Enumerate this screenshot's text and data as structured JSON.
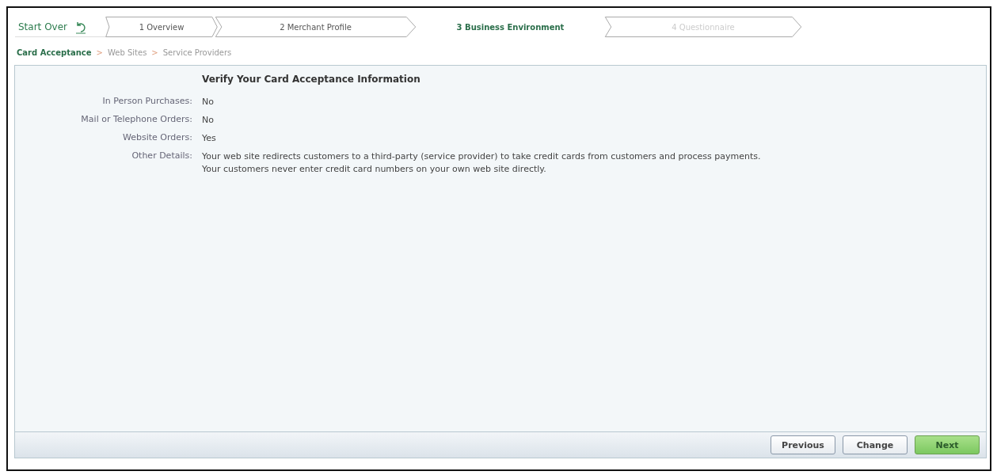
{
  "start_over": {
    "label": "Start Over"
  },
  "steps": [
    {
      "label": "1 Overview",
      "selected": false,
      "disabled": false
    },
    {
      "label": "2 Merchant Profile",
      "selected": false,
      "disabled": false
    },
    {
      "label": "3 Business Environment",
      "selected": true,
      "disabled": false
    },
    {
      "label": "4 Questionnaire",
      "selected": false,
      "disabled": true
    }
  ],
  "breadcrumb": [
    {
      "label": "Card Acceptance",
      "selected": true
    },
    {
      "label": "Web Sites",
      "selected": false
    },
    {
      "label": "Service Providers",
      "selected": false
    }
  ],
  "breadcrumb_separator": ">",
  "heading": "Verify Your Card Acceptance Information",
  "fields": [
    {
      "label": "In Person Purchases:",
      "value": "No"
    },
    {
      "label": "Mail or Telephone Orders:",
      "value": "No"
    },
    {
      "label": "Website Orders:",
      "value": "Yes"
    },
    {
      "label": "Other Details:",
      "value": "Your web site redirects customers to a third-party (service provider) to take credit cards from customers and process payments.\nYour customers never enter credit card numbers on your own web site directly."
    }
  ],
  "buttons": [
    {
      "label": "Previous",
      "kind": "secondary"
    },
    {
      "label": "Change",
      "kind": "secondary"
    },
    {
      "label": "Next",
      "kind": "primary"
    }
  ]
}
